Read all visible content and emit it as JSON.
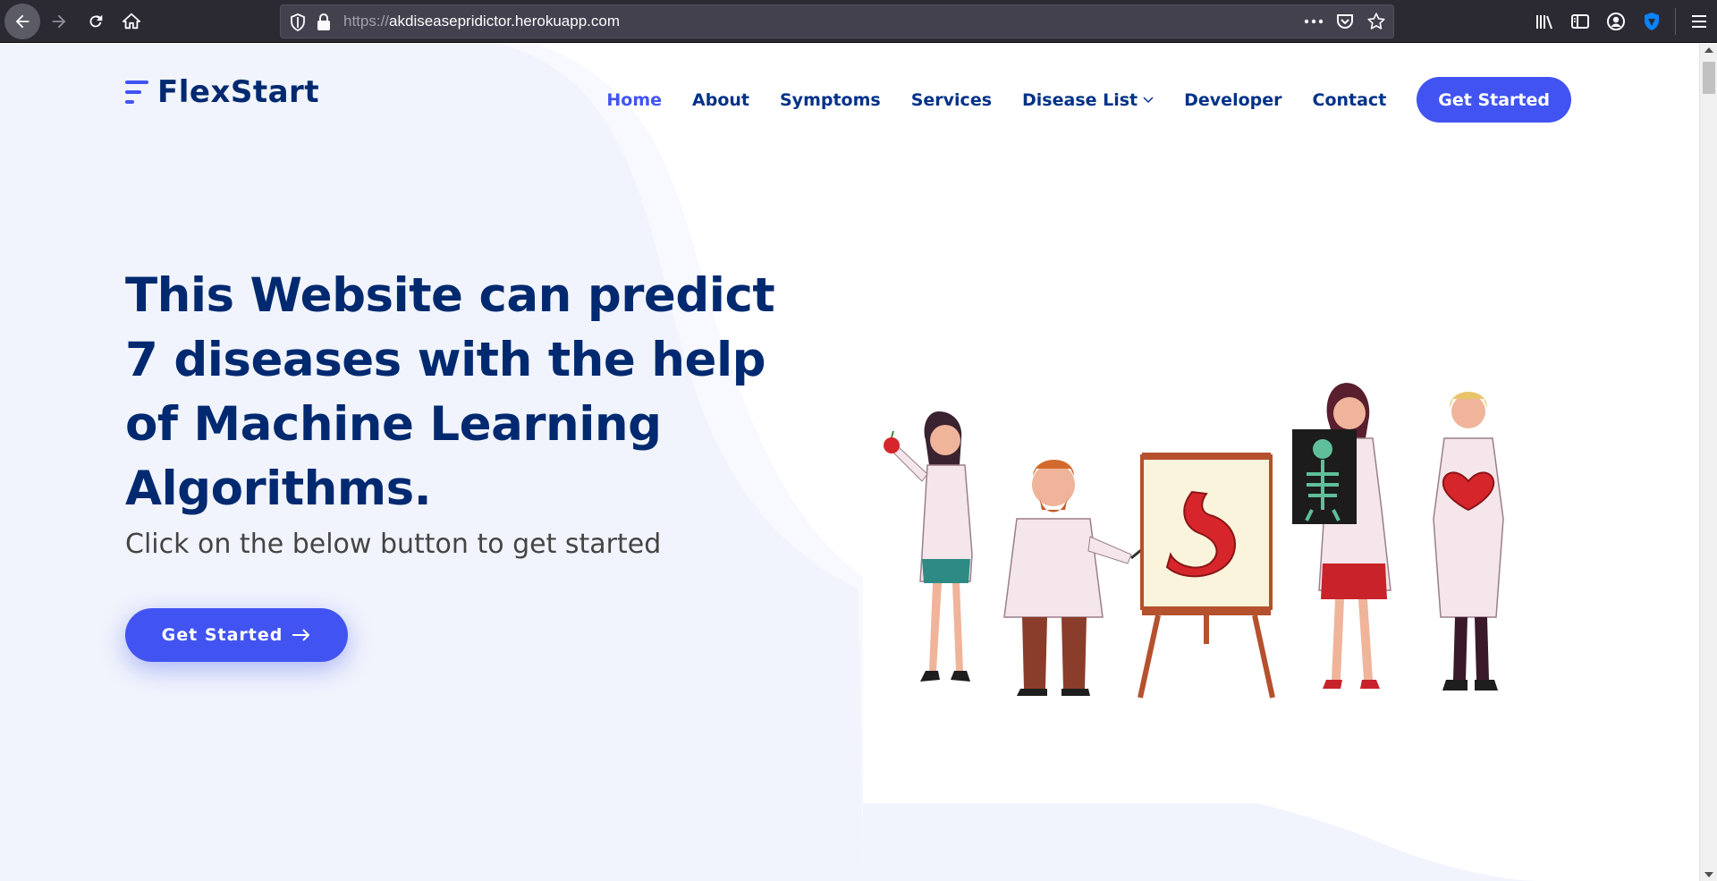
{
  "browser": {
    "url_scheme": "https://",
    "url_host": "akdiseasepridictor.herokuapp.com",
    "icons": [
      "back-icon",
      "forward-icon",
      "reload-icon",
      "home-icon",
      "tracking-shield-icon",
      "lock-icon",
      "more-actions-icon",
      "pocket-icon",
      "bookmark-star-icon",
      "library-icon",
      "sidebar-icon",
      "account-icon",
      "extension-shield-icon",
      "hamburger-menu-icon"
    ]
  },
  "site": {
    "logo_text": "FlexStart",
    "nav": {
      "home": "Home",
      "about": "About",
      "symptoms": "Symptoms",
      "services": "Services",
      "disease_list": "Disease List",
      "developer": "Developer",
      "contact": "Contact",
      "get_started": "Get Started"
    },
    "hero": {
      "title": "This Website can predict 7 diseases with the help of Machine Learning Algorithms.",
      "subtitle": "Click on the below button to get started",
      "button": "Get Started"
    }
  },
  "colors": {
    "primary": "#4154f1",
    "heading": "#012970",
    "nav_text": "#013289",
    "hero_bg": "#f1f4fc",
    "chrome_bg": "#2b2a33"
  }
}
